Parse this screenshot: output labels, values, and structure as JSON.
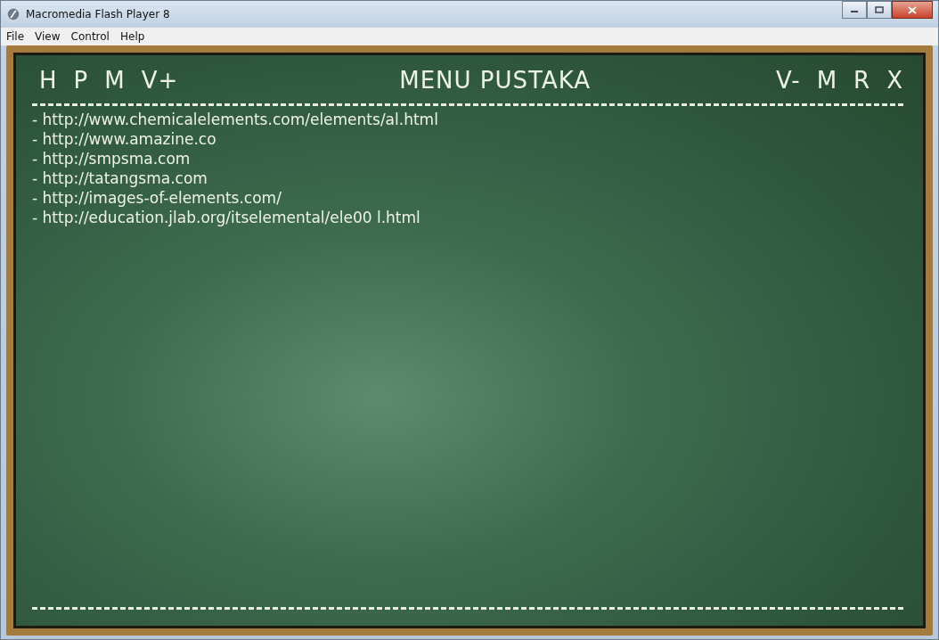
{
  "window": {
    "title": "Macromedia Flash Player 8"
  },
  "menu": [
    "File",
    "View",
    "Control",
    "Help"
  ],
  "board": {
    "nav_left": [
      "H",
      "P",
      "M",
      "V+"
    ],
    "title": "MENU PUSTAKA",
    "nav_right": [
      "V-",
      "M",
      "R",
      "X"
    ],
    "links": [
      "- http://www.chemicalelements.com/elements/al.html",
      "- http://www.amazine.co",
      "- http://smpsma.com",
      "- http://tatangsma.com",
      "- http://images-of-elements.com/",
      "- http://education.jlab.org/itselemental/ele00 l.html"
    ]
  }
}
